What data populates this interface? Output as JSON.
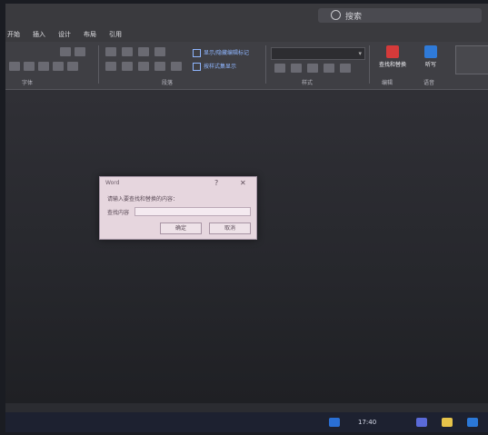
{
  "titlebar": {
    "search_placeholder": "搜索"
  },
  "menu": {
    "tabs": [
      "开始",
      "插入",
      "设计",
      "布局",
      "引用"
    ]
  },
  "ribbon": {
    "check_options": [
      "显示/隐藏编辑标记",
      "按样式集显示"
    ],
    "group_labels": [
      "字体",
      "段落",
      "样式",
      "编辑",
      "语音"
    ],
    "buttons": [
      {
        "label": "查找和替换",
        "icon": "find-replace-icon",
        "color": "#d43a3a"
      },
      {
        "label": "听写",
        "icon": "dictate-icon",
        "color": "#2f7ad8"
      }
    ]
  },
  "dialog": {
    "title": "Word",
    "message": "请输入要查找和替换的内容：",
    "field_label": "查找内容",
    "field_value": "",
    "ok_label": "确定",
    "cancel_label": "取消"
  },
  "taskbar": {
    "time": "17:40",
    "icons": [
      "windows-start-icon",
      "teams-icon",
      "file-explorer-icon",
      "word-icon"
    ],
    "icon_colors": [
      "#2a6fd4",
      "#5a6ad8",
      "#e6c34a",
      "#2b78d8"
    ]
  }
}
